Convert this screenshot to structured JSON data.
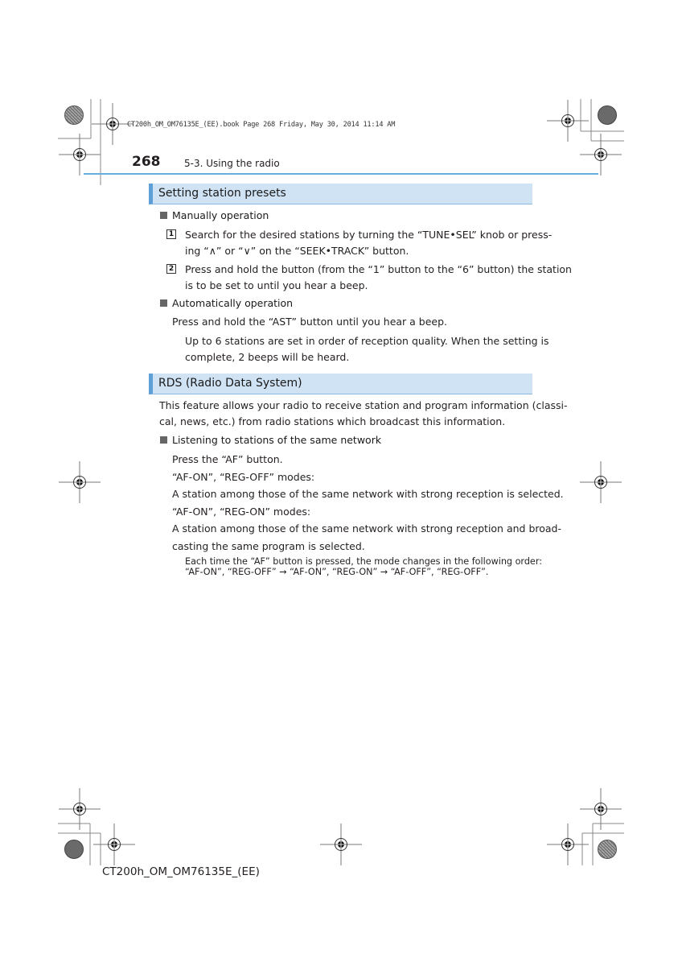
{
  "print_slug": "CT200h_OM_OM76135E_(EE).book  Page 268  Friday, May 30, 2014  11:14 AM",
  "header": {
    "page_number": "268",
    "section": "5-3. Using the radio"
  },
  "sections": [
    {
      "title": "Setting station presets",
      "subsections": [
        {
          "title": "Manually operation",
          "steps": [
            {
              "num": "1",
              "lines": [
                "Search for the desired stations by turning the “TUNE•SEL” knob or press-",
                "ing “∧” or “∨” on the “SEEK•TRACK” button."
              ]
            },
            {
              "num": "2",
              "lines": [
                "Press and hold the button (from the “1” button to the “6” button) the station",
                "is to be set to until you hear a beep."
              ]
            }
          ]
        },
        {
          "title": "Automatically operation",
          "text": "Press and hold the “AST” button until you hear a beep.",
          "indent_lines": [
            "Up to 6 stations are set in order of reception quality. When the setting is",
            "complete, 2 beeps will be heard."
          ]
        }
      ]
    },
    {
      "title": "RDS (Radio Data System)",
      "intro_lines": [
        "This feature allows your radio to receive station and program information (classi-",
        "cal, news, etc.) from radio stations which broadcast this information."
      ],
      "subsections": [
        {
          "title": "Listening to stations of the same network",
          "lines": [
            "Press the “AF” button.",
            "“AF-ON”, “REG-OFF” modes:",
            "A station among those of the same network with strong reception is selected.",
            "“AF-ON”, “REG-ON” modes:",
            "A station among those of the same network with strong reception and broad-",
            "casting the same program is selected."
          ],
          "note_lines": [
            "Each time the “AF” button is pressed, the mode changes in the following order:",
            "“AF-ON”, “REG-OFF” → “AF-ON”, “REG-ON” → “AF-OFF”, “REG-OFF”."
          ]
        }
      ]
    }
  ],
  "footer": {
    "doc_code": "CT200h_OM_OM76135E_(EE)"
  }
}
